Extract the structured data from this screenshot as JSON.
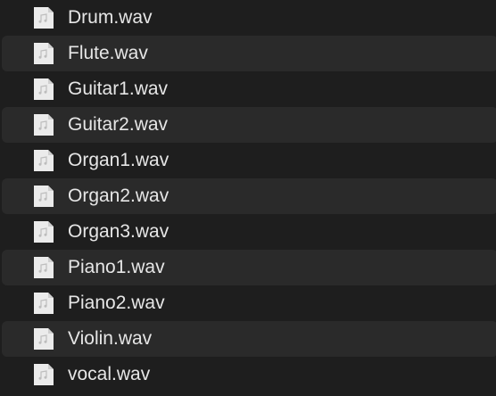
{
  "file_list": {
    "icon": "audio-file-icon",
    "items": [
      {
        "label": "Drum.wav"
      },
      {
        "label": "Flute.wav"
      },
      {
        "label": "Guitar1.wav"
      },
      {
        "label": "Guitar2.wav"
      },
      {
        "label": "Organ1.wav"
      },
      {
        "label": "Organ2.wav"
      },
      {
        "label": "Organ3.wav"
      },
      {
        "label": "Piano1.wav"
      },
      {
        "label": "Piano2.wav"
      },
      {
        "label": "Violin.wav"
      },
      {
        "label": "vocal.wav"
      }
    ]
  }
}
